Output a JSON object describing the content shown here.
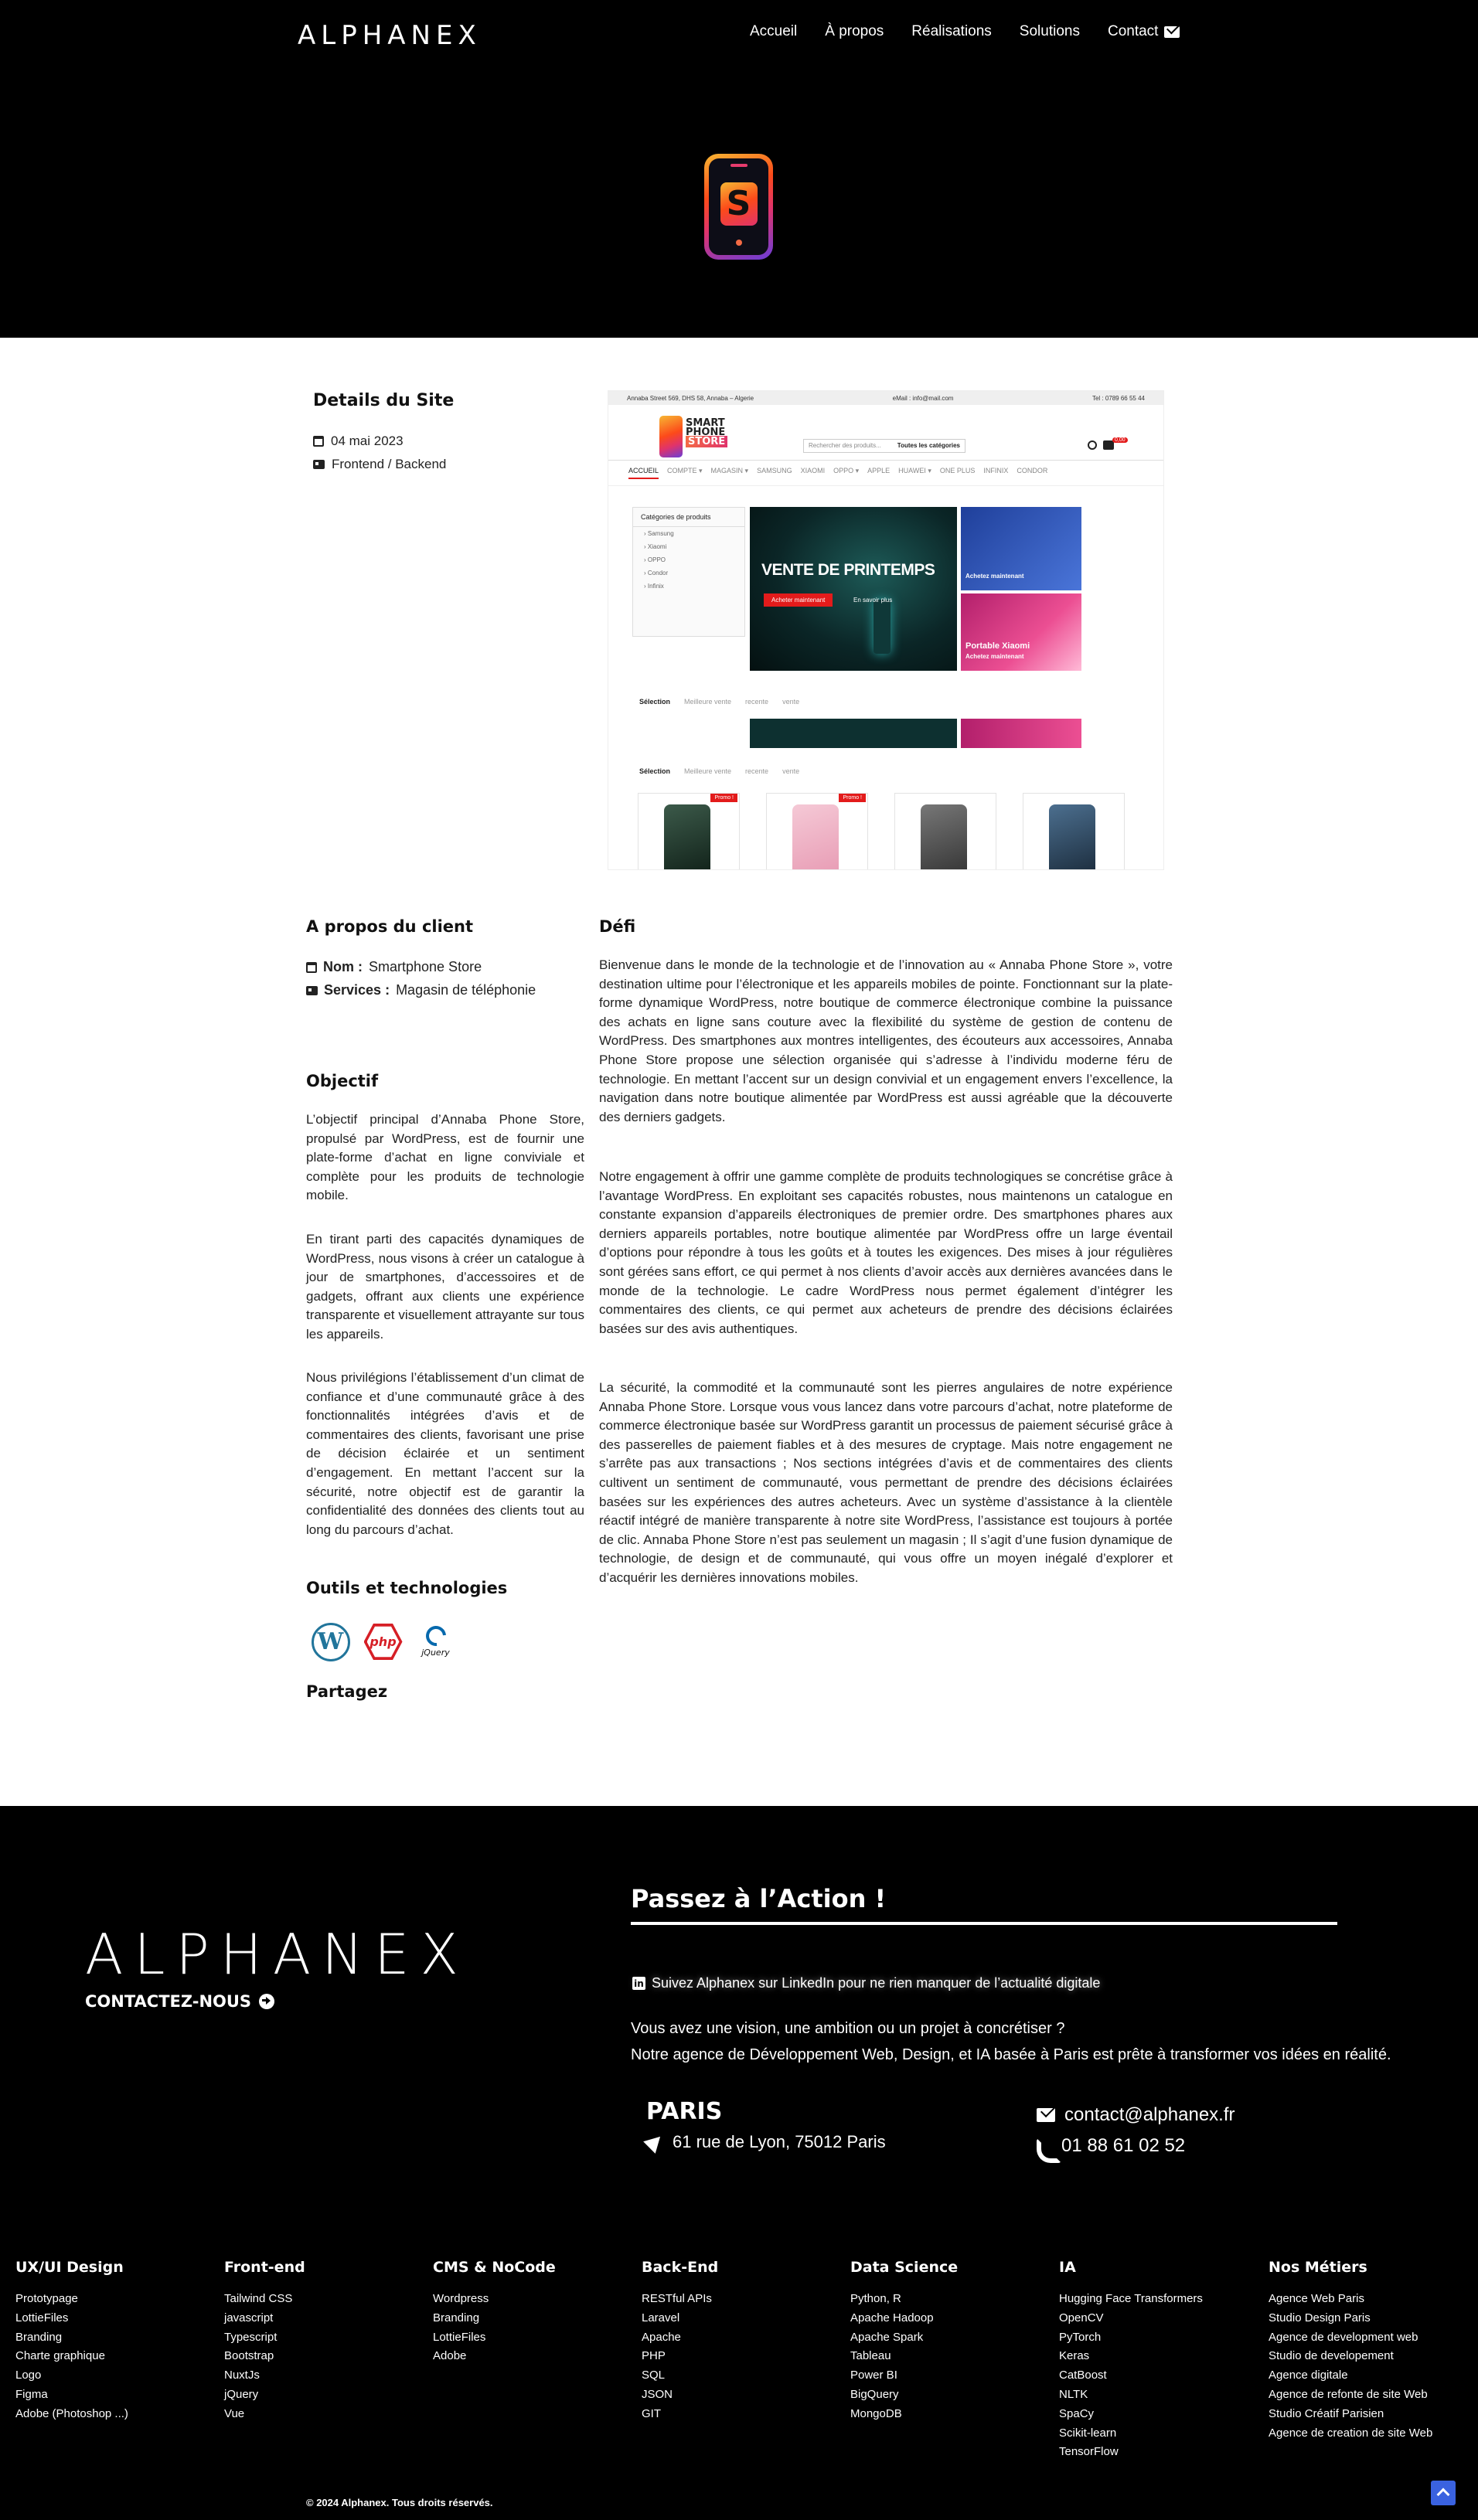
{
  "header": {
    "logo": "ALPHANEX",
    "nav": [
      "Accueil",
      "À propos",
      "Réalisations",
      "Solutions",
      "Contact"
    ]
  },
  "details": {
    "title": "Details du Site",
    "date": "04 mai 2023",
    "type": "Frontend / Backend"
  },
  "screenshot": {
    "topbar_address": "Annaba Street 569, DHS 58, Annaba – Algerie",
    "topbar_email": "eMail : info@mail.com",
    "topbar_tel": "Tel : 0789 66 55 44",
    "logo_line1": "SMART",
    "logo_line2": "PHONE",
    "logo_line3": "STORE",
    "search_placeholder": "Rechercher des produits...",
    "search_categories": "Toutes les catégories",
    "cart_badge": "0,00",
    "nav": [
      "ACCUEIL",
      "COMPTE ▾",
      "MAGASIN ▾",
      "SAMSUNG",
      "XIAOMI",
      "OPPO ▾",
      "APPLE",
      "HUAWEI ▾",
      "ONE PLUS",
      "INFINIX",
      "CONDOR"
    ],
    "categories_title": "Catégories de produits",
    "categories": [
      "Samsung",
      "Xiaomi",
      "OPPO",
      "Condor",
      "Infinix"
    ],
    "banner_title": "VENTE DE PRINTEMPS",
    "banner_btn_buy": "Acheter maintenant",
    "banner_btn_more": "En savoir plus",
    "card_buy": "Achetez maintenant",
    "card2_title": "Portable Xiaomi",
    "tabs": [
      "Sélection",
      "Meilleure vente",
      "recente",
      "vente"
    ],
    "promo": "Promo !"
  },
  "client": {
    "title": "A propos du client",
    "name_label": "Nom :",
    "name": "Smartphone Store",
    "services_label": "Services :",
    "services": "Magasin de téléphonie"
  },
  "objectif": {
    "title": "Objectif",
    "paragraphs": [
      "L’objectif principal d’Annaba Phone Store, propulsé par WordPress, est de fournir une plate-forme d’achat en ligne conviviale et complète pour les produits de technologie mobile.",
      "En tirant parti des capacités dynamiques de WordPress, nous visons à créer un catalogue à jour de smartphones, d’accessoires et de gadgets, offrant aux clients une expérience transparente et visuellement attrayante sur tous les appareils.",
      "Nous privilégions l’établissement d’un climat de confiance et d’une communauté grâce à des fonctionnalités intégrées d’avis et de commentaires des clients, favorisant une prise de décision éclairée et un sentiment d’engagement. En mettant l’accent sur la sécurité, notre objectif est de garantir la confidentialité des données des clients tout au long du parcours d’achat."
    ]
  },
  "defi": {
    "title": "Défi",
    "paragraphs": [
      "Bienvenue dans le monde de la technologie et de l’innovation au « Annaba Phone Store », votre destination ultime pour l’électronique et les appareils mobiles de pointe. Fonctionnant sur la plate-forme dynamique WordPress, notre boutique de commerce électronique combine la puissance des achats en ligne sans couture avec la flexibilité du système de gestion de contenu de WordPress. Des smartphones aux montres intelligentes, des écouteurs aux accessoires, Annaba Phone Store propose une sélection organisée qui s’adresse à l’individu moderne féru de technologie. En mettant l’accent sur un design convivial et un engagement envers l’excellence, la navigation dans notre boutique alimentée par WordPress est aussi agréable que la découverte des derniers gadgets.",
      "Notre engagement à offrir une gamme complète de produits technologiques se concrétise grâce à l’avantage WordPress. En exploitant ses capacités robustes, nous maintenons un catalogue en constante expansion d’appareils électroniques de premier ordre. Des smartphones phares aux derniers appareils portables, notre boutique alimentée par WordPress offre un large éventail d’options pour répondre à tous les goûts et à toutes les exigences. Des mises à jour régulières sont gérées sans effort, ce qui permet à nos clients d’avoir accès aux dernières avancées dans le monde de la technologie. Le cadre WordPress nous permet également d’intégrer les commentaires des clients, ce qui permet aux acheteurs de prendre des décisions éclairées basées sur des avis authentiques.",
      "La sécurité, la commodité et la communauté sont les pierres angulaires de notre expérience Annaba Phone Store. Lorsque vous vous lancez dans votre parcours d’achat, notre plateforme de commerce électronique basée sur WordPress garantit un processus de paiement sécurisé grâce à des passerelles de paiement fiables et à des mesures de cryptage. Mais notre engagement ne s’arrête pas aux transactions ; Nos sections intégrées d’avis et de commentaires des clients cultivent un sentiment de communauté, vous permettant de prendre des décisions éclairées basées sur les expériences des autres acheteurs. Avec un système d’assistance à la clientèle réactif intégré de manière transparente à notre site WordPress, l’assistance est toujours à portée de clic. Annaba Phone Store n’est pas seulement un magasin ; Il s’agit d’une fusion dynamique de technologie, de design et de communauté, qui vous offre un moyen inégalé d’explorer et d’acquérir les dernières innovations mobiles."
    ]
  },
  "tools": {
    "title": "Outils et technologies",
    "items": [
      "wordpress-icon",
      "php-icon",
      "jquery-icon"
    ],
    "php_label": "php",
    "jquery_label": "jQuery"
  },
  "share": {
    "title": "Partagez"
  },
  "footer": {
    "logo": "ALPHANEX",
    "contact": "CONTACTEZ-NOUS",
    "cta": "Passez à l’Action !",
    "linkedin": "Suivez Alphanex sur LinkedIn pour ne rien manquer de l’actualité digitale",
    "vision_line1": "Vous avez une vision, une ambition ou un projet à concrétiser ?",
    "vision_line2": "Notre agence de Développement Web, Design, et IA basée à Paris est prête à transformer vos idées en réalité.",
    "city": "PARIS",
    "address": "61 rue de Lyon, 75012 Paris",
    "email": "contact@alphanex.fr",
    "phone": "01 88 61 02 52",
    "columns": [
      {
        "title": "UX/UI Design",
        "items": [
          "Prototypage",
          "LottieFiles",
          "Branding",
          "Charte graphique",
          "Logo",
          "Figma",
          "Adobe (Photoshop ...)"
        ]
      },
      {
        "title": "Front-end",
        "items": [
          "Tailwind CSS",
          "javascript",
          "Typescript",
          "Bootstrap",
          "NuxtJs",
          "jQuery",
          "Vue"
        ]
      },
      {
        "title": "CMS & NoCode",
        "items": [
          "Wordpress",
          "Branding",
          "LottieFiles",
          "Adobe"
        ]
      },
      {
        "title": "Back-End",
        "items": [
          "RESTful APIs",
          "Laravel",
          "Apache",
          "PHP",
          "SQL",
          "JSON",
          "GIT"
        ]
      },
      {
        "title": "Data Science",
        "items": [
          "Python, R",
          "Apache Hadoop",
          "Apache Spark",
          "Tableau",
          "Power BI",
          "BigQuery",
          "MongoDB"
        ]
      },
      {
        "title": "IA",
        "items": [
          "Hugging Face Transformers",
          "OpenCV",
          "PyTorch",
          "Keras",
          "CatBoost",
          "NLTK",
          "SpaCy",
          "Scikit-learn",
          "TensorFlow"
        ]
      },
      {
        "title": "Nos Métiers",
        "items": [
          "Agence Web Paris",
          "Studio Design Paris",
          "Agence de development web",
          "Studio de developement",
          "Agence digitale",
          "Agence de refonte de site Web",
          "Studio Créatif Parisien",
          "Agence de creation de site Web"
        ]
      }
    ],
    "copyright": "© 2024 Alphanex. Tous droits réservés."
  }
}
